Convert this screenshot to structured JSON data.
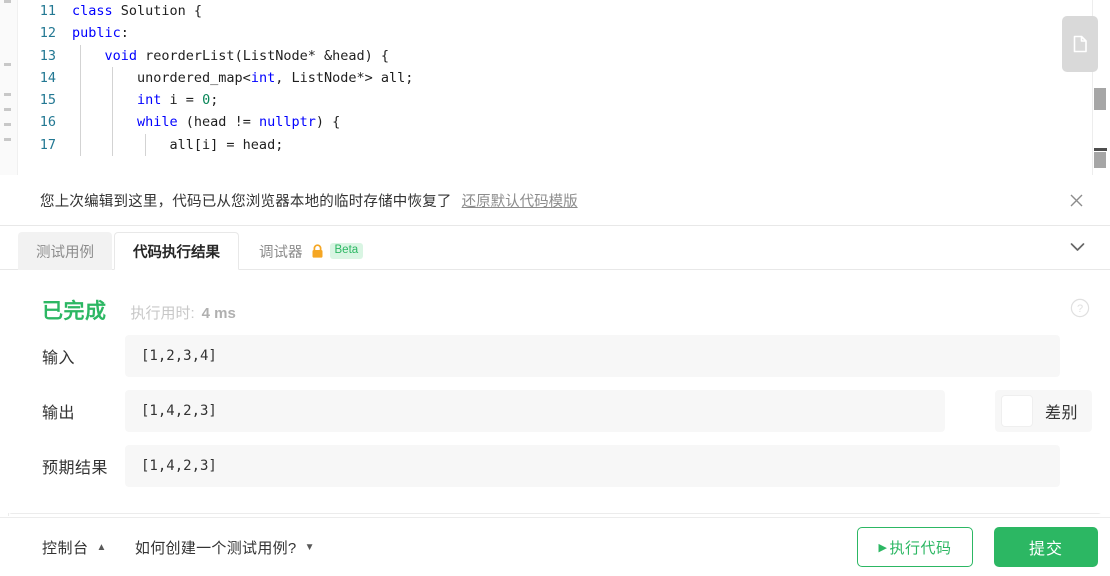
{
  "editor": {
    "copy_icon": "copy-icon",
    "lines": [
      {
        "number": "11",
        "tokens": [
          {
            "t": "class",
            "c": "kw"
          },
          {
            "t": " Solution {",
            "c": "code-text"
          }
        ],
        "indent_guides": 0
      },
      {
        "number": "12",
        "tokens": [
          {
            "t": "public",
            "c": "kw"
          },
          {
            "t": ":",
            "c": "code-text"
          }
        ],
        "indent_guides": 0
      },
      {
        "number": "13",
        "tokens": [
          {
            "t": "    ",
            "c": "code-text"
          },
          {
            "t": "void",
            "c": "kw"
          },
          {
            "t": " reorderList(ListNode* &head) {",
            "c": "code-text"
          }
        ],
        "indent_guides": 1
      },
      {
        "number": "14",
        "tokens": [
          {
            "t": "        unordered_map<",
            "c": "code-text"
          },
          {
            "t": "int",
            "c": "kw"
          },
          {
            "t": ", ListNode*> all;",
            "c": "code-text"
          }
        ],
        "indent_guides": 2
      },
      {
        "number": "15",
        "tokens": [
          {
            "t": "        ",
            "c": "code-text"
          },
          {
            "t": "int",
            "c": "kw"
          },
          {
            "t": " i = ",
            "c": "code-text"
          },
          {
            "t": "0",
            "c": "num"
          },
          {
            "t": ";",
            "c": "code-text"
          }
        ],
        "indent_guides": 2
      },
      {
        "number": "16",
        "tokens": [
          {
            "t": "        ",
            "c": "code-text"
          },
          {
            "t": "while",
            "c": "kw"
          },
          {
            "t": " (head != ",
            "c": "code-text"
          },
          {
            "t": "nullptr",
            "c": "kw"
          },
          {
            "t": ") {",
            "c": "code-text"
          }
        ],
        "indent_guides": 2
      },
      {
        "number": "17",
        "tokens": [
          {
            "t": "            all[i] = head;",
            "c": "code-text"
          }
        ],
        "indent_guides": 3
      }
    ]
  },
  "notice": {
    "message": "您上次编辑到这里，代码已从您浏览器本地的临时存储中恢复了",
    "link_label": "还原默认代码模版",
    "close_icon": "close-icon"
  },
  "tabs": {
    "items": [
      {
        "label": "测试用例",
        "active": false
      },
      {
        "label": "代码执行结果",
        "active": true
      },
      {
        "label": "调试器",
        "active": false,
        "lock_icon": "lock-icon",
        "badge": "Beta"
      }
    ],
    "collapse_icon": "chevron-down-icon"
  },
  "result": {
    "status": "已完成",
    "runtime_label": "执行用时:",
    "runtime_value": "4 ms",
    "help_icon": "question-circle-icon",
    "rows": [
      {
        "label": "输入",
        "value": "[1,2,3,4]"
      },
      {
        "label": "输出",
        "value": "[1,4,2,3]"
      },
      {
        "label": "预期结果",
        "value": "[1,4,2,3]"
      }
    ],
    "diff": {
      "label": "差别",
      "checked": false
    }
  },
  "bottom": {
    "console_label": "控制台",
    "console_caret": "▲",
    "howto_label": "如何创建一个测试用例?",
    "howto_caret": "▼",
    "run_label": "执行代码",
    "run_play_glyph": "▶",
    "submit_label": "提交"
  },
  "colors": {
    "accent_green": "#2cb763",
    "badge_bg": "#d9f5e3",
    "lock_orange": "#f5a623",
    "keyword_blue": "#0000ff",
    "number_green": "#098658",
    "line_number": "#237893",
    "box_bg": "#f7f7f7"
  }
}
